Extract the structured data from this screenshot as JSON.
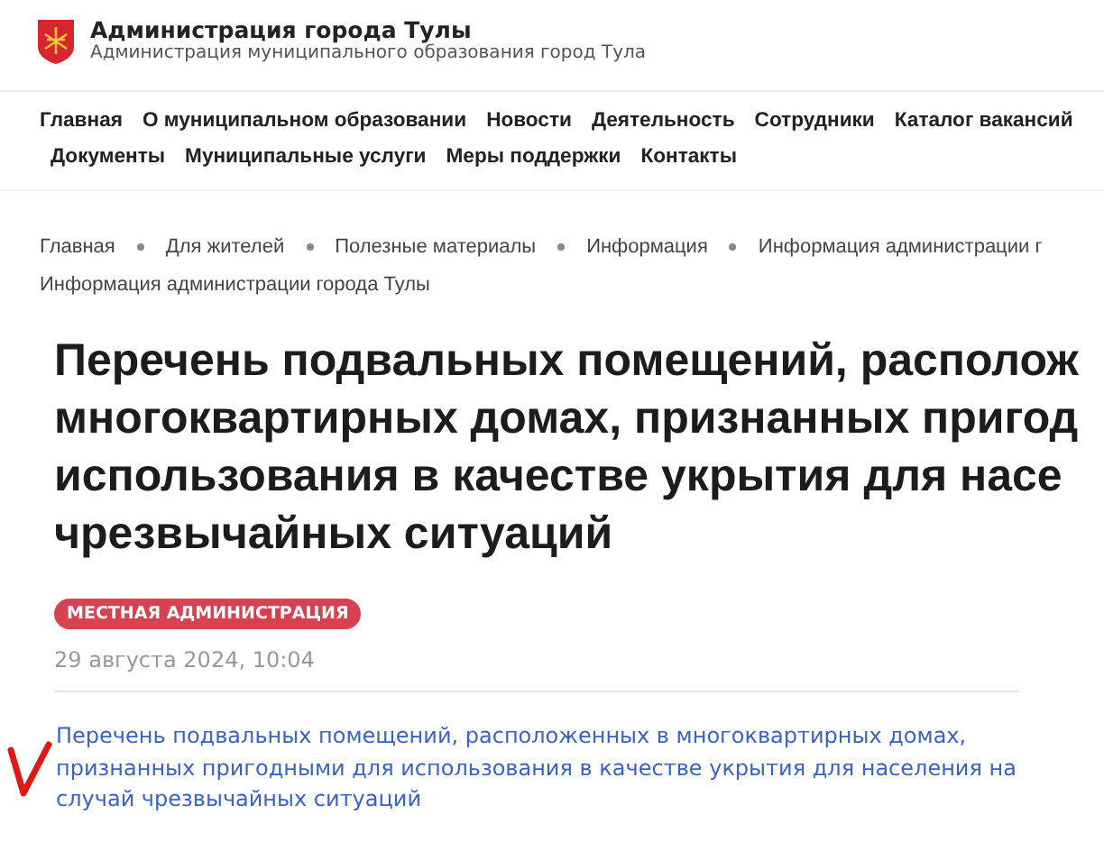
{
  "header": {
    "title": "Администрация города Тулы",
    "subtitle": "Администрация муниципального образования город Тула"
  },
  "nav_rows": [
    [
      "Главная",
      "О муниципальном образовании",
      "Новости",
      "Деятельность",
      "Сотрудники",
      "Каталог вакансий"
    ],
    [
      "Документы",
      "Муниципальные услуги",
      "Меры поддержки",
      "Контакты"
    ]
  ],
  "breadcrumbs": [
    "Главная",
    "Для жителей",
    "Полезные материалы",
    "Информация",
    "Информация администрации г"
  ],
  "section_title": "Информация администрации города Тулы",
  "article": {
    "title_lines": [
      "Перечень подвальных помещений, располож",
      "многоквартирных домах, признанных пригод",
      "использования в качестве укрытия для насе",
      "чрезвычайных ситуаций"
    ],
    "tag": "МЕСТНАЯ АДМИНИСТРАЦИЯ",
    "date": "29 августа 2024, 10:04",
    "link": "Перечень подвальных помещений, расположенных в многоквартирных домах, признанных пригодными для использования в качестве укрытия для населения на случай чрезвычайных ситуаций"
  }
}
